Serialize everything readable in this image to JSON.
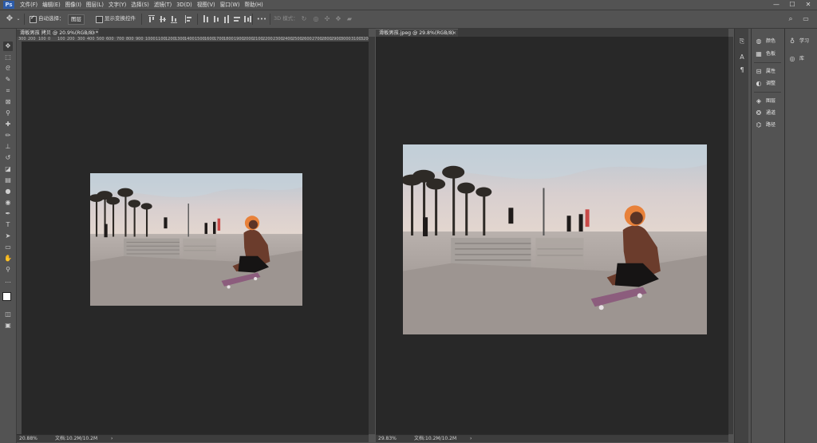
{
  "app": {
    "logo_text": "Ps",
    "menu": [
      "文件(F)",
      "编辑(E)",
      "图像(I)",
      "图层(L)",
      "文字(Y)",
      "选择(S)",
      "滤镜(T)",
      "3D(D)",
      "视图(V)",
      "窗口(W)",
      "帮助(H)"
    ],
    "window_controls": {
      "minimize": "—",
      "maximize": "☐",
      "close": "✕"
    }
  },
  "options_bar": {
    "auto_select_label": "自动选择：",
    "auto_select_checked": true,
    "layer_select_value": "图层",
    "show_transform_label": "显示变换控件",
    "show_transform_checked": false,
    "more_label": "•••",
    "mode3d_label": "3D 模式：",
    "search_icon": "search-icon",
    "workspace_icon": "workspace-icon"
  },
  "tools": [
    "move-tool",
    "marquee-tool",
    "lasso-tool",
    "quick-select-tool",
    "crop-tool",
    "frame-tool",
    "eyedropper-tool",
    "healing-brush-tool",
    "brush-tool",
    "clone-stamp-tool",
    "history-brush-tool",
    "eraser-tool",
    "gradient-tool",
    "blur-tool",
    "dodge-tool",
    "pen-tool",
    "type-tool",
    "path-select-tool",
    "rectangle-tool",
    "hand-tool",
    "zoom-tool",
    "more-tools"
  ],
  "documents": [
    {
      "tab_title": "滑板男孩 拷贝 @ 20.9%(RGB/8) *",
      "close": "×",
      "ruler_labels": [
        "300",
        "200",
        "100",
        "0",
        "100",
        "200",
        "300",
        "400",
        "500",
        "600",
        "700",
        "800",
        "900",
        "1000",
        "1100",
        "1200",
        "1300",
        "1400",
        "1500",
        "1600",
        "1700",
        "1800",
        "1900",
        "2000",
        "2100",
        "2200",
        "2300",
        "2400",
        "2500",
        "2600",
        "2700",
        "2800",
        "2900",
        "3000",
        "3100",
        "3200"
      ],
      "zoom": "20.88%",
      "doc_info": "文档:10.2M/10.2M",
      "arrow": "›"
    },
    {
      "tab_title": "滑板男孩.jpeg @ 29.8%(RGB/8)",
      "close": "×",
      "zoom": "29.83%",
      "doc_info": "文档:10.2M/10.2M",
      "arrow": "›"
    }
  ],
  "panels": {
    "strip_b": [
      {
        "icon": "color-wheel-icon",
        "label": "颜色"
      },
      {
        "icon": "swatches-icon",
        "label": "色板"
      },
      {
        "icon": "properties-icon",
        "label": "属性"
      },
      {
        "icon": "adjustments-icon",
        "label": "调整"
      },
      {
        "icon": "layers-icon",
        "label": "图层"
      },
      {
        "icon": "channels-icon",
        "label": "通道"
      },
      {
        "icon": "paths-icon",
        "label": "路径"
      }
    ],
    "strip_c": [
      {
        "icon": "lightbulb-icon",
        "label": "学习"
      },
      {
        "icon": "libraries-icon",
        "label": "库"
      }
    ]
  }
}
